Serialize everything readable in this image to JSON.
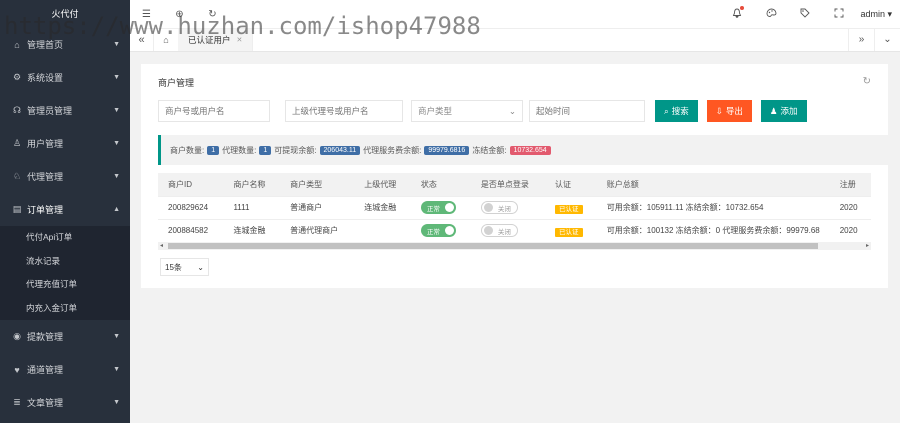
{
  "brand": "火代付",
  "watermark": "https://www.huzhan.com/ishop47988",
  "sidebar": {
    "items": [
      {
        "label": "管理首页",
        "icon": "⌂"
      },
      {
        "label": "系统设置",
        "icon": "⚙"
      },
      {
        "label": "管理员管理",
        "icon": "☊"
      },
      {
        "label": "用户管理",
        "icon": "♙"
      },
      {
        "label": "代理管理",
        "icon": "♘"
      },
      {
        "label": "订单管理",
        "icon": "▤"
      }
    ],
    "sub_items": [
      "代付Api订单",
      "流水记录",
      "代理充值订单",
      "内充入金订单"
    ],
    "bottom_items": [
      {
        "label": "提款管理",
        "icon": "◉"
      },
      {
        "label": "通道管理",
        "icon": "♥"
      },
      {
        "label": "文章管理",
        "icon": "≣"
      }
    ]
  },
  "topbar": {
    "menu_icon": "☰",
    "globe_icon": "⊕",
    "refresh_icon": "↻",
    "user": "admin ▾"
  },
  "tabs": {
    "home_icon": "⌂",
    "active_tab": "已认证用户",
    "close": "✕"
  },
  "card": {
    "title": "商户管理",
    "filters": {
      "merchant_placeholder": "商户号或用户名",
      "agent_placeholder": "上级代理号或用户名",
      "type_placeholder": "商户类型",
      "time_placeholder": "起始时间"
    },
    "buttons": {
      "search": "搜索",
      "export": "导出",
      "add": "添加"
    },
    "stats": {
      "merchant_count_label": "商户数量:",
      "merchant_count": "1",
      "agent_count_label": "代理数量:",
      "agent_count": "1",
      "available_label": "可提现余额:",
      "available": "206043.11",
      "agent_fee_label": "代理服务费余额:",
      "agent_fee": "99979.6816",
      "frozen_label": "冻结金额:",
      "frozen": "10732.654"
    },
    "table": {
      "headers": [
        "商户ID",
        "商户名称",
        "商户类型",
        "上级代理",
        "状态",
        "是否单点登录",
        "认证",
        "账户总额",
        "注册"
      ],
      "rows": [
        {
          "id": "200829624",
          "name": "1111",
          "type": "普通商户",
          "agent": "连城金融",
          "status": "正常",
          "sso": "关闭",
          "auth": "已认证",
          "balance": "可用余额：105911.11 冻结余额：10732.654",
          "reg": "2020"
        },
        {
          "id": "200884582",
          "name": "连城金融",
          "type": "普通代理商户",
          "agent": "",
          "status": "正常",
          "sso": "关闭",
          "auth": "已认证",
          "balance": "可用余额：100132 冻结余额：0 代理服务费余额：99979.68",
          "reg": "2020"
        }
      ]
    },
    "page_size": "15条"
  }
}
